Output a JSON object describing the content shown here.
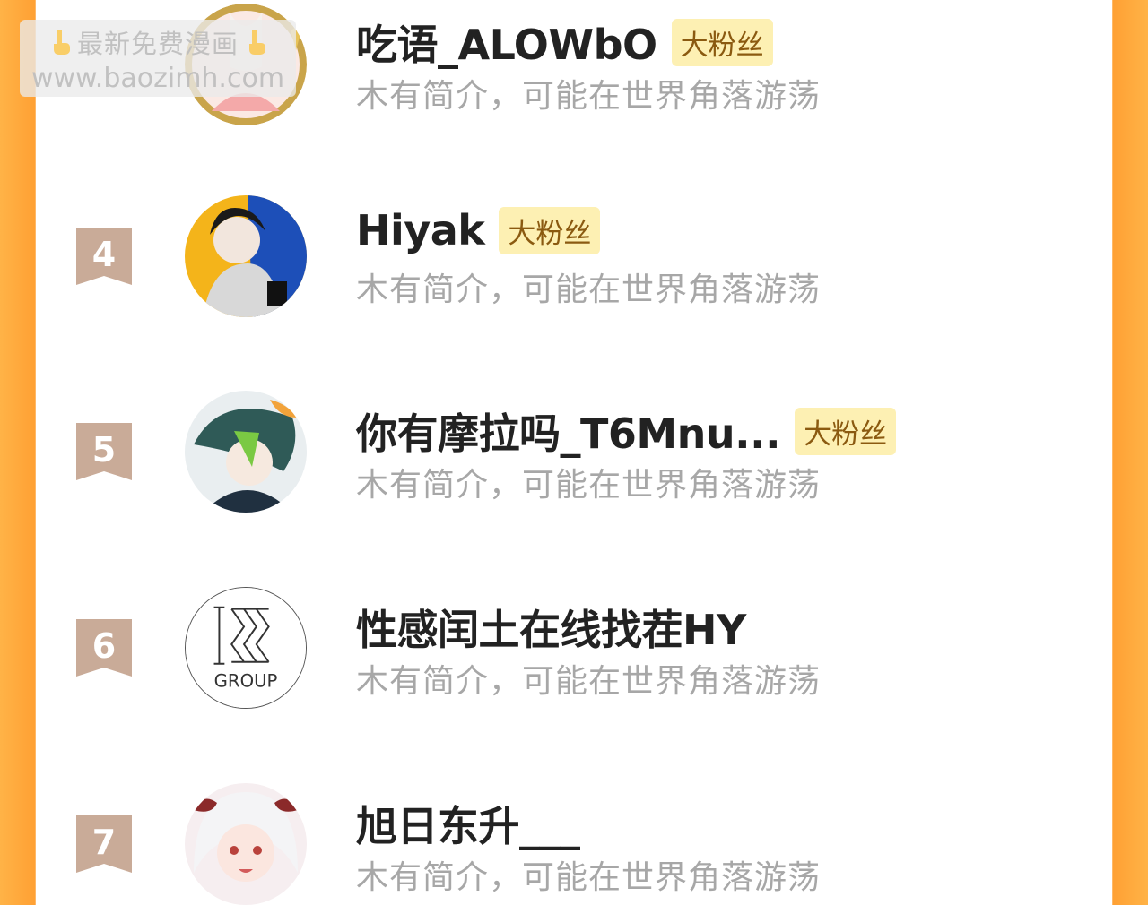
{
  "watermark": {
    "line1": "最新免费漫画",
    "line2": "www.baozimh.com"
  },
  "colors": {
    "frame": "#ffa033",
    "badge_bg": "#fdf0b3",
    "badge_text": "#8b5a10",
    "rank_ribbon": "#c9ab98",
    "name": "#222222",
    "bio": "#a7a7a7"
  },
  "fans": [
    {
      "rank": "",
      "name": "吃语_ALOWbO",
      "badge": "大粉丝",
      "bio": "木有简介，可能在世界角落游荡",
      "avatar_icon": "anime-avatar-crown-icon"
    },
    {
      "rank": "4",
      "name": "Hiyak",
      "badge": "大粉丝",
      "bio": "木有简介，可能在世界角落游荡",
      "avatar_icon": "anime-avatar-icon"
    },
    {
      "rank": "5",
      "name": "你有摩拉吗_T6Mnu...",
      "badge": "大粉丝",
      "bio": "木有简介，可能在世界角落游荡",
      "avatar_icon": "anime-avatar-icon"
    },
    {
      "rank": "6",
      "name": "性感闰土在线找茬HY",
      "badge": "",
      "bio": "木有简介，可能在世界角落游荡",
      "avatar_icon": "group-logo-icon",
      "avatar_text": "GROUP"
    },
    {
      "rank": "7",
      "name": "旭日东升___",
      "badge": "",
      "bio": "木有简介，可能在世界角落游荡",
      "avatar_icon": "anime-avatar-icon"
    }
  ]
}
